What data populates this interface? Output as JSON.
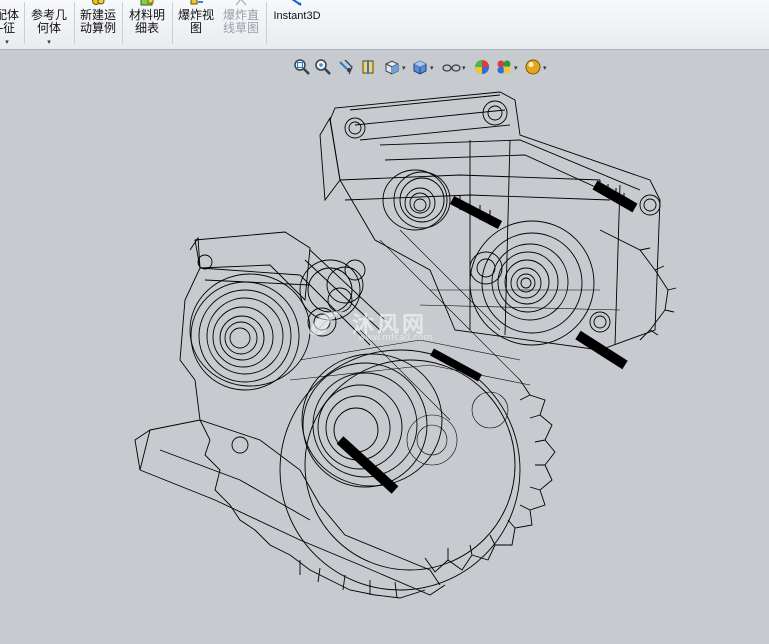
{
  "ribbon": {
    "items": [
      {
        "line1": "配体",
        "line2": "-征",
        "has_dropdown": true
      },
      {
        "line1": "参考几",
        "line2": "何体",
        "has_dropdown": true
      },
      {
        "line1": "新建运",
        "line2": "动算例"
      },
      {
        "line1": "材料明",
        "line2": "细表"
      },
      {
        "line1": "爆炸视",
        "line2": "图"
      },
      {
        "line1": "爆炸直",
        "line2": "线草图",
        "disabled": true
      },
      {
        "line1": "Instant3D"
      }
    ],
    "dropdown_glyph": "▾"
  },
  "view_toolbar": {
    "tools": [
      {
        "icon": "zoom-to-fit-icon"
      },
      {
        "icon": "zoom-to-area-icon"
      },
      {
        "icon": "previous-view-icon"
      },
      {
        "icon": "section-view-icon"
      },
      {
        "icon": "view-orientation-icon",
        "has_dropdown": true
      },
      {
        "icon": "display-style-icon",
        "has_dropdown": true
      },
      {
        "icon": "hide-show-items-icon",
        "has_dropdown": true
      },
      {
        "icon": "edit-appearance-icon"
      },
      {
        "icon": "apply-scene-icon",
        "has_dropdown": true
      },
      {
        "icon": "view-settings-icon",
        "has_dropdown": true
      }
    ],
    "dropdown_glyph": "▾"
  },
  "viewport": {
    "display_style": "wireframe",
    "background_color": "#c7cacf",
    "line_color": "#000000"
  },
  "watermark": {
    "text": "沐风网",
    "url": "www.mfcad.com"
  }
}
